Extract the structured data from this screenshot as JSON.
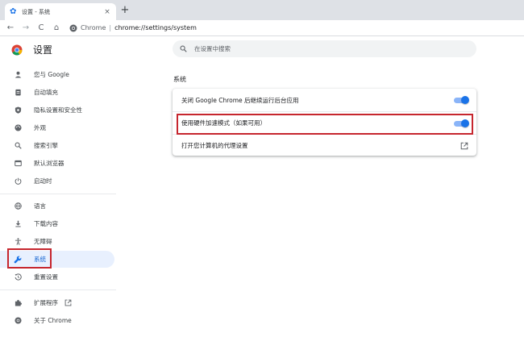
{
  "browser": {
    "tab": {
      "title": "设置 - 系统",
      "close_glyph": "×"
    },
    "new_tab_glyph": "+",
    "toolbar": {
      "back_glyph": "←",
      "forward_glyph": "→",
      "reload_glyph": "C",
      "home_glyph": "⌂",
      "site_name": "Chrome",
      "separator": "|",
      "url": "chrome://settings/system"
    }
  },
  "sidebar": {
    "title": "设置",
    "items": [
      {
        "label": "您与 Google",
        "icon": "person-icon"
      },
      {
        "label": "自动填充",
        "icon": "clipboard-icon"
      },
      {
        "label": "隐私设置和安全性",
        "icon": "shield-icon"
      },
      {
        "label": "外观",
        "icon": "palette-icon"
      },
      {
        "label": "搜索引擎",
        "icon": "search-icon"
      },
      {
        "label": "默认浏览器",
        "icon": "browser-window-icon"
      },
      {
        "label": "启动时",
        "icon": "power-icon"
      },
      {
        "label": "语言",
        "icon": "globe-icon"
      },
      {
        "label": "下载内容",
        "icon": "download-icon"
      },
      {
        "label": "无障碍",
        "icon": "accessibility-icon"
      },
      {
        "label": "系统",
        "icon": "wrench-icon",
        "active": true
      },
      {
        "label": "重置设置",
        "icon": "reset-icon"
      },
      {
        "label": "扩展程序",
        "icon": "puzzle-icon"
      },
      {
        "label": "关于 Chrome",
        "icon": "chrome-icon"
      }
    ]
  },
  "main": {
    "search_placeholder": "在设置中搜索",
    "section_title": "系统",
    "settings": [
      {
        "label": "关闭 Google Chrome 后继续运行后台应用",
        "control": "toggle",
        "enabled": true
      },
      {
        "label": "使用硬件加速模式（如果可用）",
        "control": "toggle",
        "enabled": true
      },
      {
        "label": "打开您计算机的代理设置",
        "control": "open-external-icon"
      }
    ]
  },
  "colors": {
    "accent": "#1a73e8",
    "toggle_track": "#8ab4f8",
    "active_nav_bg": "#e8f0fe",
    "highlight_annotation": "#c6262e",
    "tabstrip_bg": "#dee1e6"
  }
}
